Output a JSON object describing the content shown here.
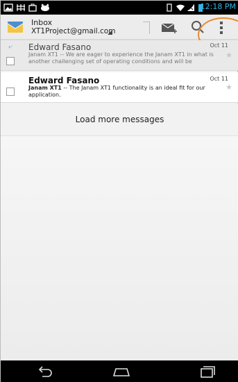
{
  "status_bar": {
    "time": "12:18 PM"
  },
  "action_bar": {
    "title": "Inbox",
    "account": "XT1Project@gmail.com"
  },
  "messages": [
    {
      "sender": "Edward Fasano",
      "date": "Oct 11",
      "subject": "",
      "snippet": "Janam XT1 -- We are eager to experience the Janam XT1 in what is another challenging set of operating conditions and will be",
      "read": true
    },
    {
      "sender": "Edward Fasano",
      "date": "Oct 11",
      "subject": "Janam XT1",
      "snippet": " -- The Janam XT1 functionality is an ideal fit for our application.",
      "read": false
    }
  ],
  "load_more_label": "Load more messages",
  "colors": {
    "accent": "#33b5e5",
    "highlight": "#e98a2d"
  },
  "icons": [
    "picture-icon",
    "grid-icon",
    "bag-icon",
    "cat-icon",
    "vibrate-icon",
    "wifi-icon",
    "signal-icon",
    "battery-icon",
    "gmail-logo-icon",
    "compose-icon",
    "search-icon",
    "overflow-menu-icon",
    "reply-icon",
    "star-icon",
    "back-icon",
    "home-icon",
    "recents-icon"
  ]
}
